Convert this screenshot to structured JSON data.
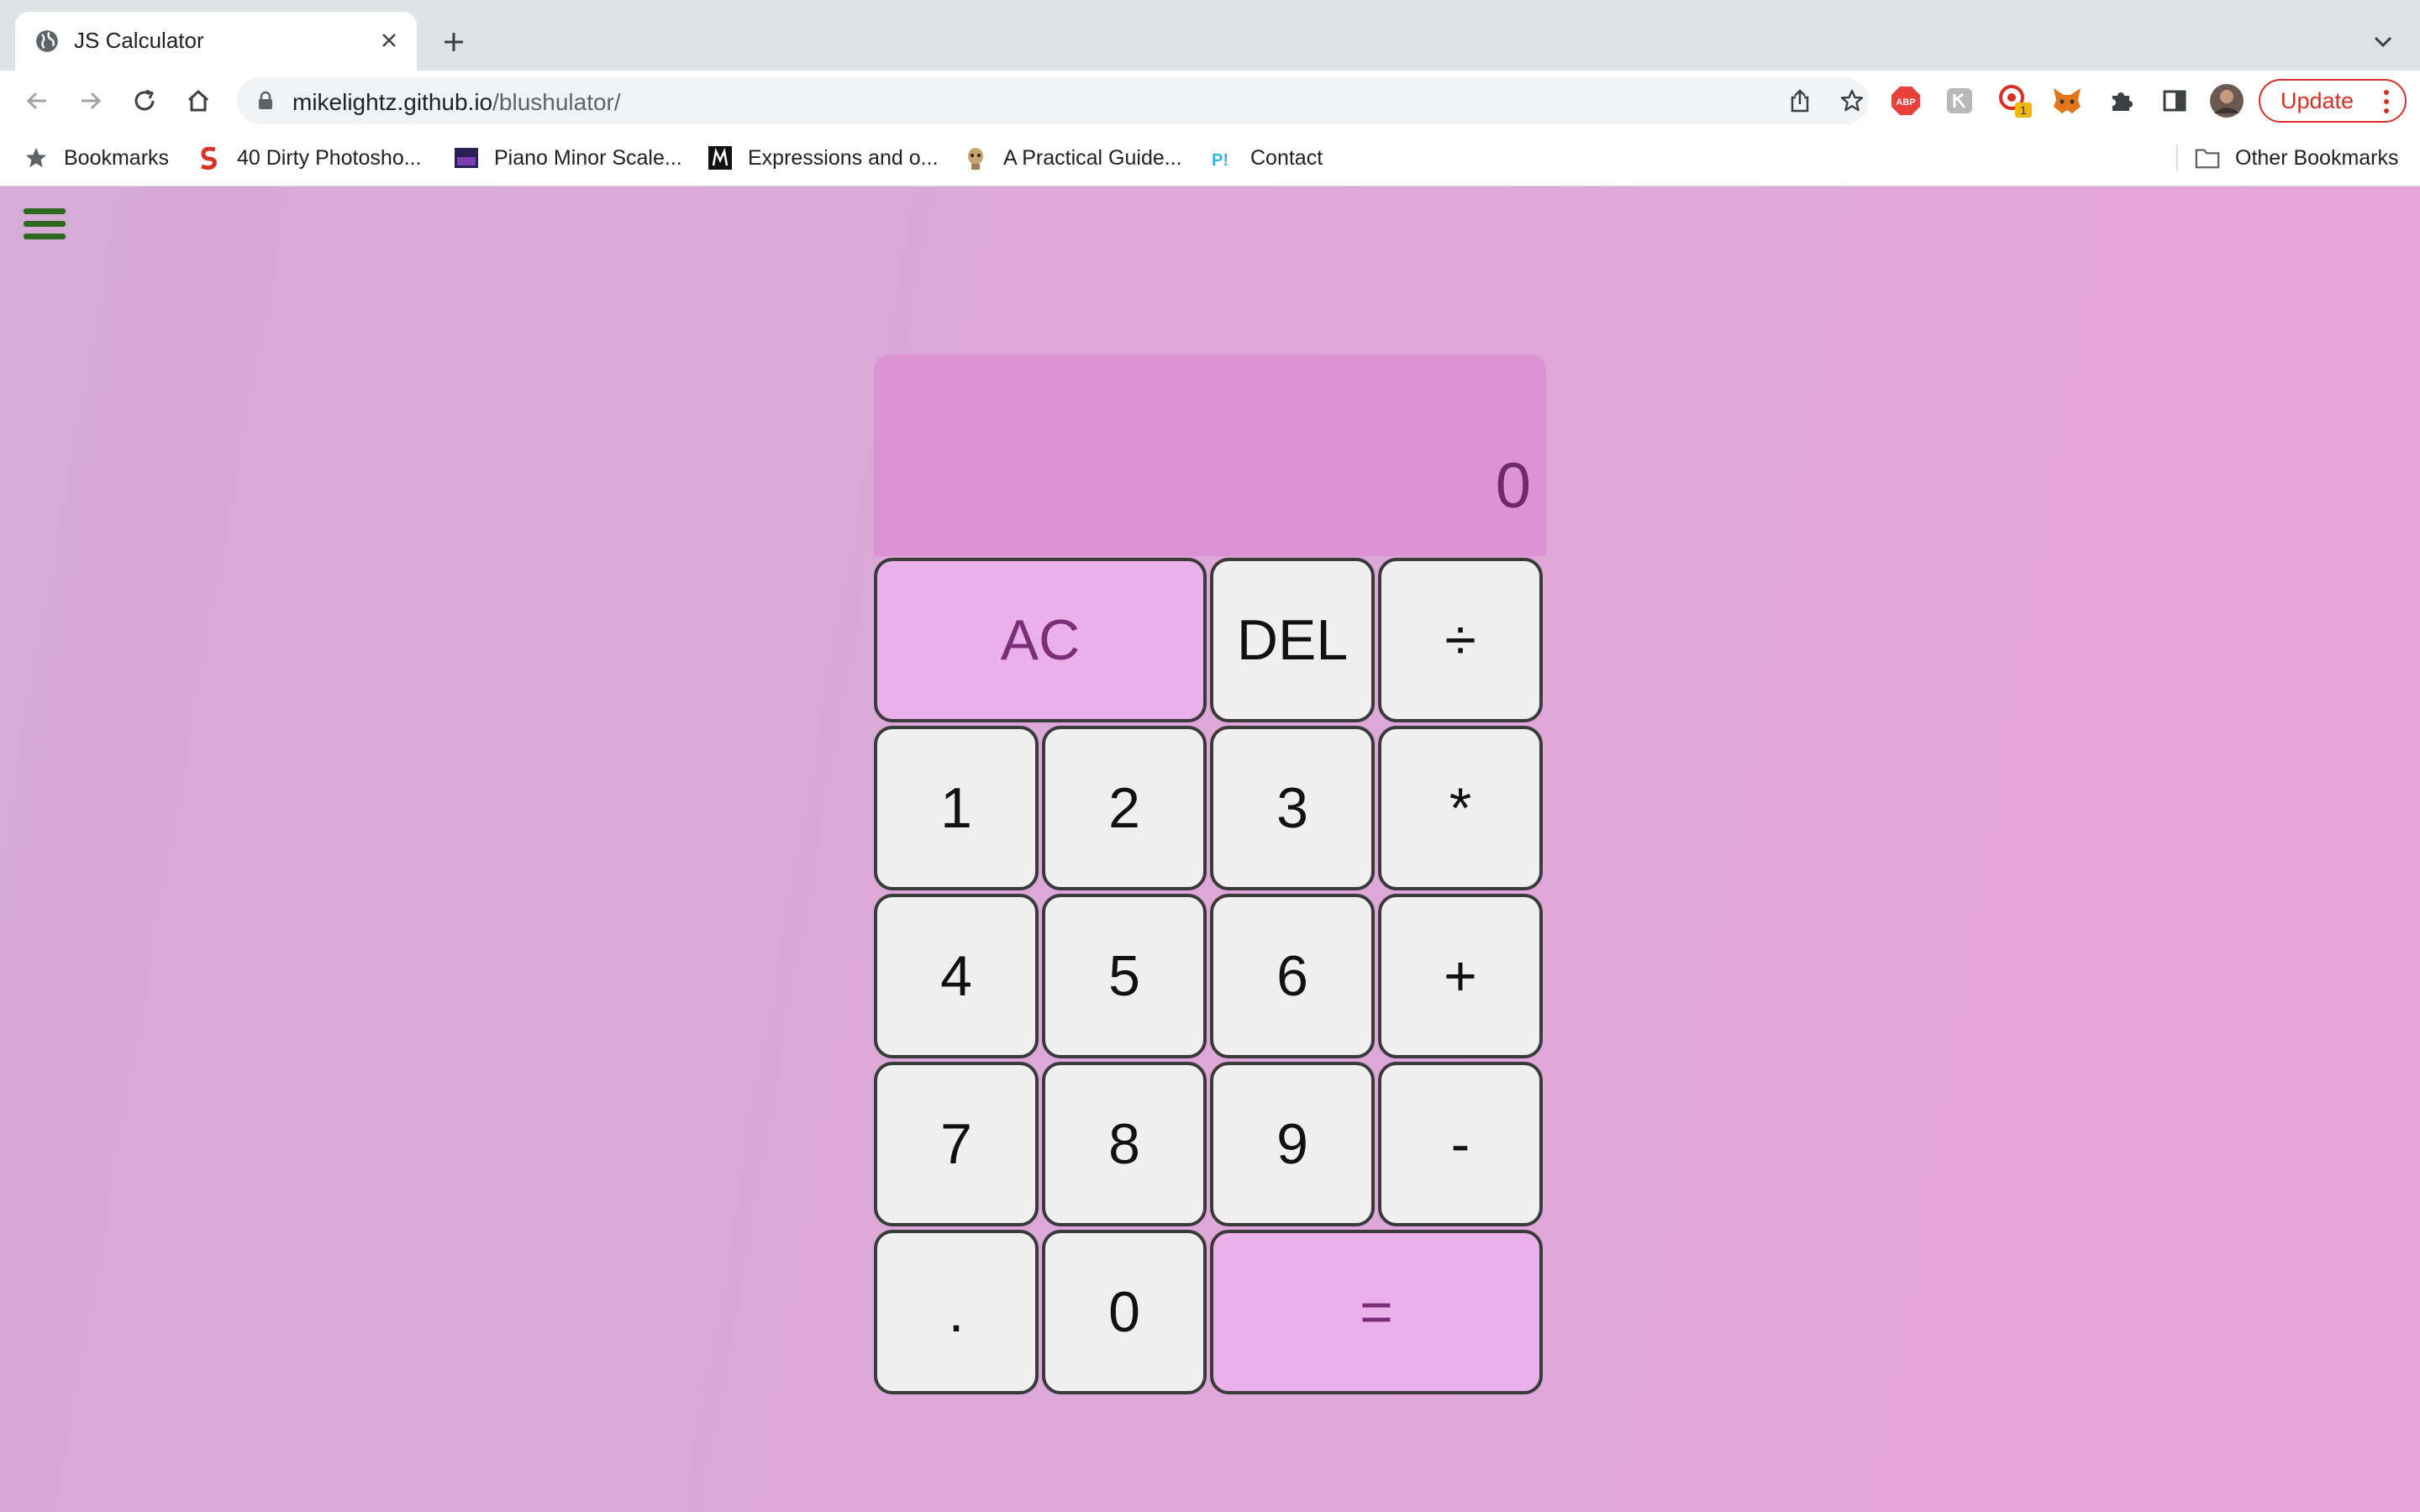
{
  "browser": {
    "tab": {
      "title": "JS Calculator",
      "favicon": "globe-icon"
    },
    "toolbar": {
      "url_host": "mikelightz.github.io",
      "url_path": "/blushulator/",
      "update_label": "Update"
    },
    "bookmarks": {
      "items": [
        {
          "label": "Bookmarks",
          "icon": "star-icon"
        },
        {
          "label": "40 Dirty Photosho...",
          "icon": "s-logo-icon"
        },
        {
          "label": "Piano Minor Scale...",
          "icon": "piano-thumb-icon"
        },
        {
          "label": "Expressions and o...",
          "icon": "m-logo-icon"
        },
        {
          "label": "A Practical Guide...",
          "icon": "meerkat-icon"
        },
        {
          "label": "Contact",
          "icon": "p-logo-icon"
        }
      ],
      "other": "Other Bookmarks"
    },
    "extensions": [
      "adblock-icon",
      "ext-grey-icon",
      "ext-badge-icon",
      "metamask-icon",
      "puzzle-icon",
      "sidepanel-icon",
      "avatar"
    ],
    "extension_badge": "1"
  },
  "calculator": {
    "display": "0",
    "keys": {
      "ac": "AC",
      "del": "DEL",
      "divide": "÷",
      "one": "1",
      "two": "2",
      "three": "3",
      "multiply": "*",
      "four": "4",
      "five": "5",
      "six": "6",
      "plus": "+",
      "seven": "7",
      "eight": "8",
      "nine": "9",
      "minus": "-",
      "dot": ".",
      "zero": "0",
      "equals": "="
    },
    "colors": {
      "display_bg": "#db93d4",
      "accent_key": "#ebb0ea",
      "accent_text": "#7a2f78",
      "menu_icon": "#2d6a1f"
    }
  }
}
